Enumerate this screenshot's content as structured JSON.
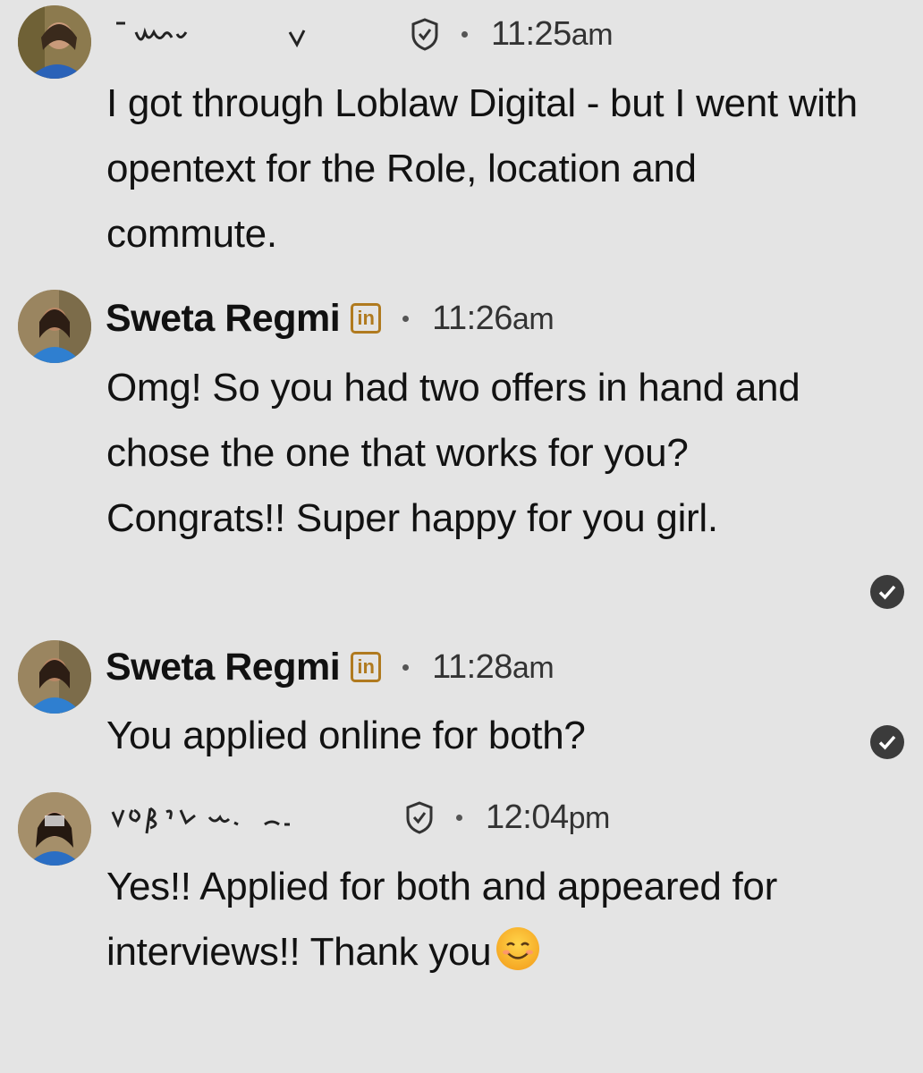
{
  "messages": [
    {
      "sender": "",
      "time": "11:25",
      "ampm": "am",
      "text": "I got through Loblaw Digital - but I went with opentext for the Role, location and commute.",
      "verified_icon": "shield-check-icon"
    },
    {
      "sender": "Sweta Regmi",
      "badge": "in",
      "time": "11:26",
      "ampm": "am",
      "text": "Omg! So you had two offers in hand and chose the one that works for you? Congrats!!  Super happy for you girl.",
      "status_icon": "read-check-icon"
    },
    {
      "sender": "Sweta Regmi",
      "badge": "in",
      "time": "11:28",
      "ampm": "am",
      "text": "You applied online for both?",
      "status_icon": "read-check-icon"
    },
    {
      "sender": "",
      "time": "12:04",
      "ampm": "pm",
      "text": "Yes!! Applied for both and appeared for interviews!! Thank you",
      "emoji": "smiling-face-icon",
      "verified_icon": "shield-check-icon"
    }
  ],
  "colors": {
    "background": "#e4e4e4",
    "linkedin_badge": "#b07a1f",
    "read_check": "#3b3b3b",
    "text": "#121212"
  }
}
